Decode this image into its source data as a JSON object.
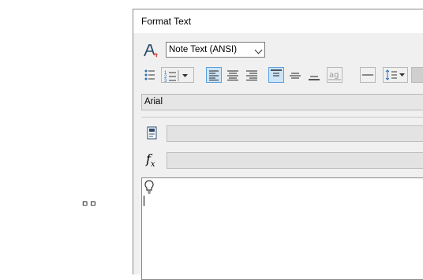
{
  "stray_text": "ㅁㅁ",
  "dialog": {
    "title": "Format Text",
    "style_combo": {
      "value": "Note Text (ANSI)"
    },
    "font_field": {
      "value": "Arial"
    },
    "fx_label": "f",
    "fx_sub": "x"
  },
  "colors": {
    "selected_bg": "#cce4f7",
    "selected_border": "#5aa0dc",
    "dialog_bg": "#f0f0f0"
  }
}
